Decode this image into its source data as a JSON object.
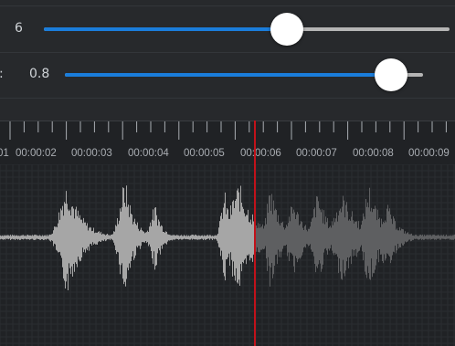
{
  "controls": {
    "slider1": {
      "value_text": "6",
      "fraction": 0.6
    },
    "slider2": {
      "label_fragment": ":",
      "value_text": "0.8",
      "fraction": 0.91
    }
  },
  "timeline": {
    "labels": [
      "01",
      "00:00:02",
      "00:00:03",
      "00:00:04",
      "00:00:05",
      "00:00:06",
      "00:00:07",
      "00:00:08",
      "00:00:09"
    ],
    "colors": {
      "waveform_played": "#a6a6a6",
      "waveform_unplayed": "#5e5f61",
      "playhead": "#c1121a",
      "accent": "#1a7ddb"
    }
  }
}
